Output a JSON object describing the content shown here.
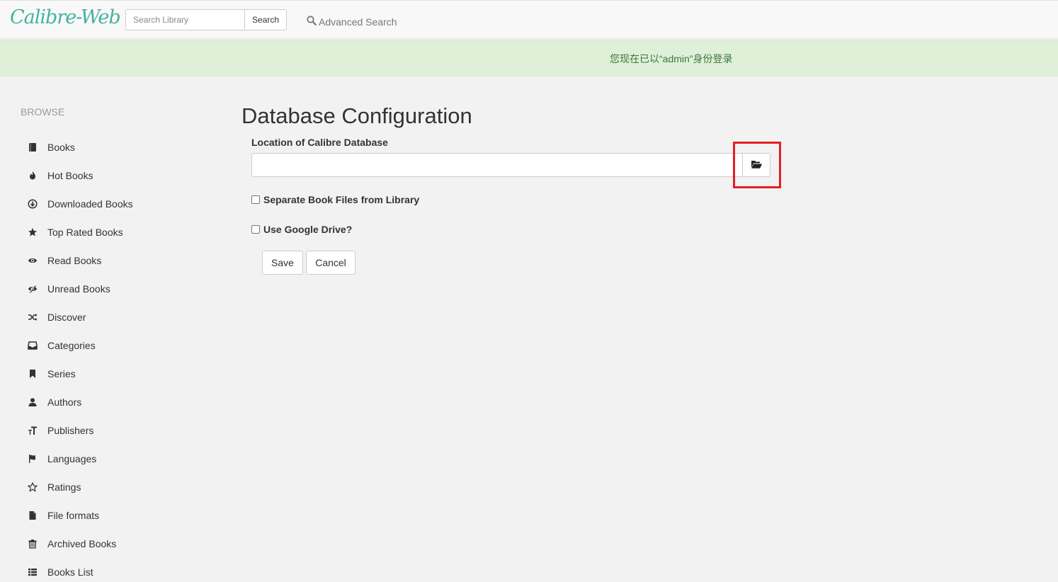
{
  "header": {
    "logo": "Calibre-Web",
    "search_placeholder": "Search Library",
    "search_button": "Search",
    "advanced_search": "Advanced Search"
  },
  "alert": {
    "message": "您现在已以“admin”身份登录",
    "color": "#3c763d"
  },
  "sidebar": {
    "header": "BROWSE",
    "items": [
      {
        "label": "Books",
        "icon": "book-icon"
      },
      {
        "label": "Hot Books",
        "icon": "fire-icon"
      },
      {
        "label": "Downloaded Books",
        "icon": "download-circle-icon"
      },
      {
        "label": "Top Rated Books",
        "icon": "star-icon"
      },
      {
        "label": "Read Books",
        "icon": "eye-icon"
      },
      {
        "label": "Unread Books",
        "icon": "eye-slash-icon"
      },
      {
        "label": "Discover",
        "icon": "shuffle-icon"
      },
      {
        "label": "Categories",
        "icon": "inbox-icon"
      },
      {
        "label": "Series",
        "icon": "bookmark-icon"
      },
      {
        "label": "Authors",
        "icon": "user-icon"
      },
      {
        "label": "Publishers",
        "icon": "text-size-icon"
      },
      {
        "label": "Languages",
        "icon": "flag-icon"
      },
      {
        "label": "Ratings",
        "icon": "star-outline-icon"
      },
      {
        "label": "File formats",
        "icon": "file-icon"
      },
      {
        "label": "Archived Books",
        "icon": "trash-icon"
      },
      {
        "label": "Books List",
        "icon": "list-icon"
      }
    ]
  },
  "main": {
    "title": "Database Configuration",
    "db_location_label": "Location of Calibre Database",
    "db_location_value": "",
    "separate_files_label": "Separate Book Files from Library",
    "google_drive_label": "Use Google Drive?",
    "save_button": "Save",
    "cancel_button": "Cancel"
  },
  "colors": {
    "brand": "#45b29d",
    "highlight": "#e41e25",
    "alert_bg": "#dff0d8"
  }
}
